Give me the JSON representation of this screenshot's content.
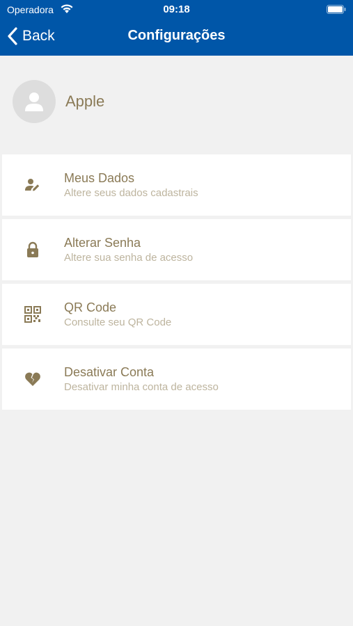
{
  "status_bar": {
    "carrier": "Operadora",
    "time": "09:18"
  },
  "nav": {
    "back_label": "Back",
    "title": "Configurações"
  },
  "profile": {
    "name": "Apple"
  },
  "menu": [
    {
      "title": "Meus Dados",
      "subtitle": "Altere seus dados cadastrais",
      "icon": "user-edit-icon"
    },
    {
      "title": "Alterar Senha",
      "subtitle": "Altere sua senha de acesso",
      "icon": "lock-icon"
    },
    {
      "title": "QR Code",
      "subtitle": "Consulte seu QR Code",
      "icon": "qr-code-icon"
    },
    {
      "title": "Desativar Conta",
      "subtitle": "Desativar minha conta de acesso",
      "icon": "broken-heart-icon"
    }
  ],
  "colors": {
    "header": "#0056a8",
    "accent": "#8a7a56",
    "subtitle": "#bdb49e",
    "background": "#f1f1f1"
  }
}
